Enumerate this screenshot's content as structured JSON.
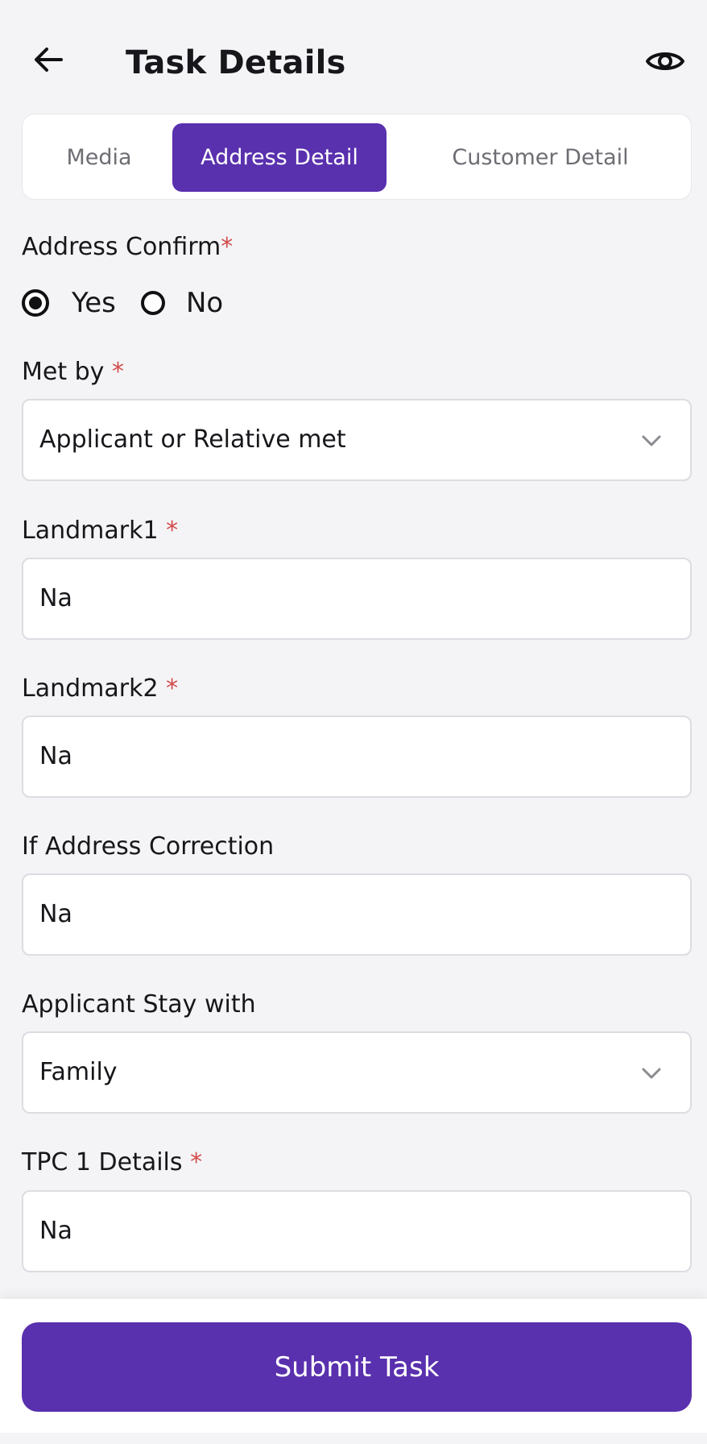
{
  "header": {
    "title": "Task Details",
    "back_icon": "arrow-left-icon",
    "view_icon": "eye-icon"
  },
  "tabs": [
    {
      "label": "Media",
      "active": false
    },
    {
      "label": "Address Detail",
      "active": true
    },
    {
      "label": "Customer Detail",
      "active": false
    }
  ],
  "form": {
    "address_confirm": {
      "label": "Address Confirm",
      "required_mark": "*",
      "options": [
        {
          "label": "Yes",
          "selected": true
        },
        {
          "label": "No",
          "selected": false
        }
      ]
    },
    "met_by": {
      "label": "Met by",
      "required_mark": "*",
      "value": "Applicant or Relative met"
    },
    "landmark1": {
      "label": "Landmark1",
      "required_mark": "*",
      "value": "Na"
    },
    "landmark2": {
      "label": "Landmark2",
      "required_mark": "*",
      "value": "Na"
    },
    "address_correction": {
      "label": "If Address Correction",
      "value": "Na"
    },
    "applicant_stay_with": {
      "label": "Applicant Stay with",
      "value": "Family"
    },
    "tpc1_details": {
      "label": "TPC 1 Details",
      "required_mark": "*",
      "value": "Na"
    }
  },
  "footer": {
    "submit_label": "Submit Task"
  },
  "colors": {
    "accent": "#5930ae",
    "required": "#d34a4a",
    "background": "#f4f4f6"
  }
}
